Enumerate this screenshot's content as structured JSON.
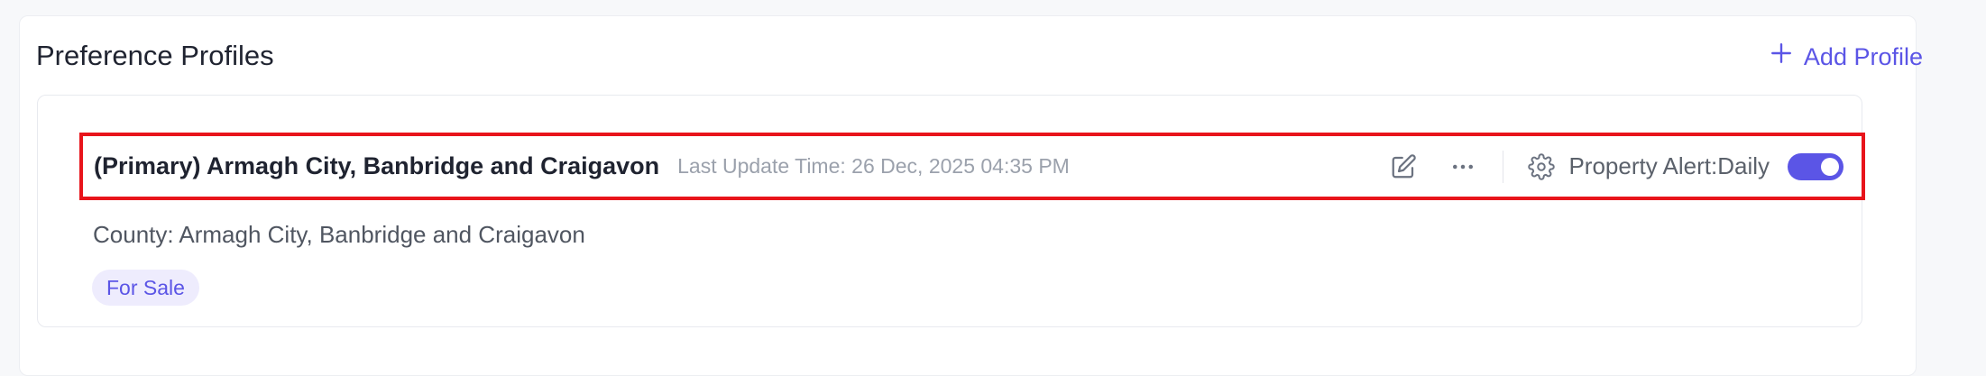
{
  "panel": {
    "title": "Preference Profiles",
    "add_button_label": "Add Profile"
  },
  "profile": {
    "name": "(Primary) Armagh City, Banbridge and Craigavon",
    "last_update": "Last Update Time: 26 Dec, 2025 04:35 PM",
    "alert_label": "Property Alert:Daily",
    "alert_enabled": true,
    "county": "County: Armagh City, Banbridge and Craigavon",
    "tag": "For Sale"
  },
  "icons": {
    "add": "plus-icon",
    "edit": "edit-icon",
    "more": "more-icon",
    "settings": "gear-icon"
  },
  "colors": {
    "accent": "#5b55e6",
    "highlight_border": "#e8141b",
    "tag_bg": "#eeecfd"
  }
}
